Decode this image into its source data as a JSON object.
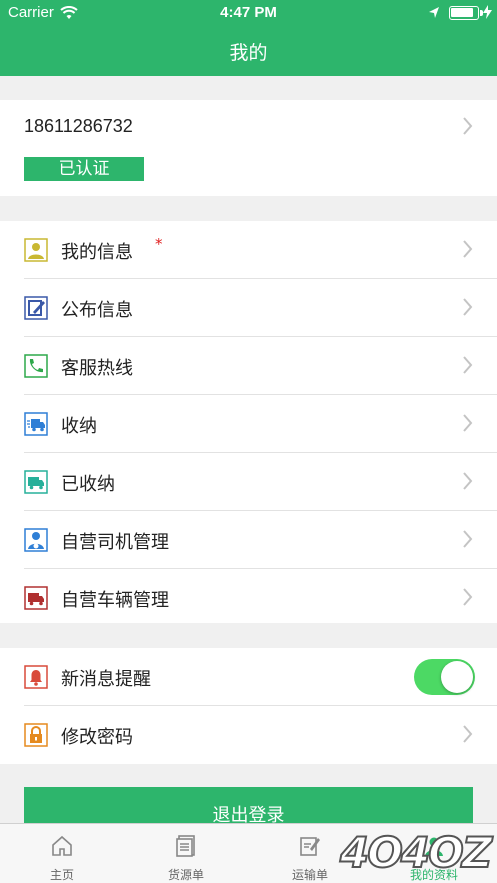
{
  "status_bar": {
    "carrier": "Carrier",
    "time": "4:47 PM"
  },
  "nav": {
    "title": "我的"
  },
  "profile": {
    "phone": "18611286732",
    "badge": "已认证"
  },
  "menu": [
    {
      "label": "我的信息",
      "icon": "user-info-icon",
      "required_mark": "*"
    },
    {
      "label": "公布信息",
      "icon": "publish-edit-icon"
    },
    {
      "label": "客服热线",
      "icon": "phone-icon"
    },
    {
      "label": "收纳",
      "icon": "truck-speed-icon"
    },
    {
      "label": "已收纳",
      "icon": "truck-icon"
    },
    {
      "label": "自营司机管理",
      "icon": "driver-icon"
    },
    {
      "label": "自营车辆管理",
      "icon": "vehicle-icon"
    }
  ],
  "settings": [
    {
      "label": "新消息提醒",
      "icon": "bell-icon",
      "toggle_on": true
    },
    {
      "label": "修改密码",
      "icon": "lock-icon"
    }
  ],
  "logout_label": "退出登录",
  "tabs": [
    {
      "label": "主页",
      "icon": "home-icon"
    },
    {
      "label": "货源单",
      "icon": "document-icon"
    },
    {
      "label": "运输单",
      "icon": "edit-note-icon"
    },
    {
      "label": "我的资料",
      "icon": "profile-icon",
      "active": true
    }
  ],
  "watermark": "4O4OZ",
  "colors": {
    "primary": "#2db56c",
    "toggle": "#4cd964",
    "background": "#f0f0f0"
  }
}
